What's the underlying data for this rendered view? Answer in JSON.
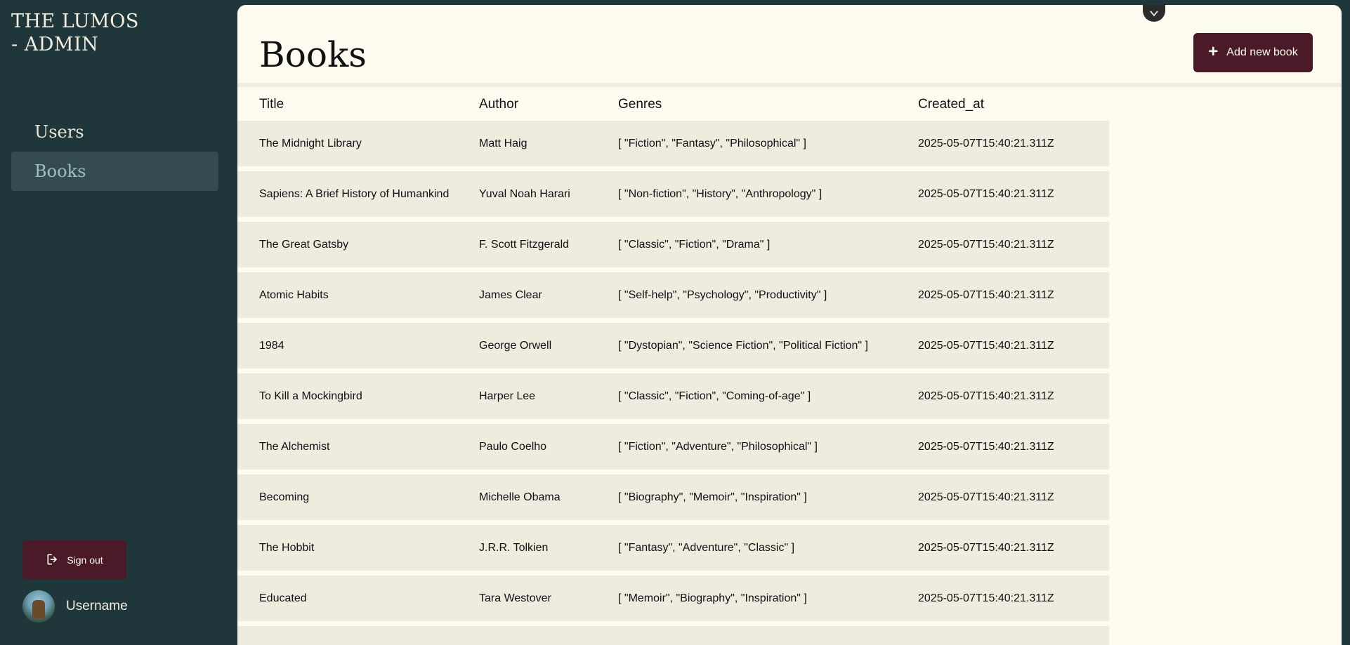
{
  "brand": {
    "title": "THE LUMOS - ADMIN"
  },
  "sidebar": {
    "items": [
      {
        "label": "Users"
      },
      {
        "label": "Books"
      }
    ],
    "signout_label": "Sign out",
    "username": "Username"
  },
  "main": {
    "title": "Books",
    "add_button_label": "Add new book",
    "columns": [
      "Title",
      "Author",
      "Genres",
      "Created_at"
    ],
    "rows": [
      {
        "title": "The Midnight Library",
        "author": "Matt Haig",
        "genres": "[ \"Fiction\", \"Fantasy\", \"Philosophical\" ]",
        "created_at": "2025-05-07T15:40:21.311Z"
      },
      {
        "title": "Sapiens: A Brief History of Humankind",
        "author": "Yuval Noah Harari",
        "genres": "[ \"Non-fiction\", \"History\", \"Anthropology\" ]",
        "created_at": "2025-05-07T15:40:21.311Z"
      },
      {
        "title": "The Great Gatsby",
        "author": "F. Scott Fitzgerald",
        "genres": "[ \"Classic\", \"Fiction\", \"Drama\" ]",
        "created_at": "2025-05-07T15:40:21.311Z"
      },
      {
        "title": "Atomic Habits",
        "author": "James Clear",
        "genres": "[ \"Self-help\", \"Psychology\", \"Productivity\" ]",
        "created_at": "2025-05-07T15:40:21.311Z"
      },
      {
        "title": "1984",
        "author": "George Orwell",
        "genres": "[ \"Dystopian\", \"Science Fiction\", \"Political Fiction\" ]",
        "created_at": "2025-05-07T15:40:21.311Z"
      },
      {
        "title": "To Kill a Mockingbird",
        "author": "Harper Lee",
        "genres": "[ \"Classic\", \"Fiction\", \"Coming-of-age\" ]",
        "created_at": "2025-05-07T15:40:21.311Z"
      },
      {
        "title": "The Alchemist",
        "author": "Paulo Coelho",
        "genres": "[ \"Fiction\", \"Adventure\", \"Philosophical\" ]",
        "created_at": "2025-05-07T15:40:21.311Z"
      },
      {
        "title": "Becoming",
        "author": "Michelle Obama",
        "genres": "[ \"Biography\", \"Memoir\", \"Inspiration\" ]",
        "created_at": "2025-05-07T15:40:21.311Z"
      },
      {
        "title": "The Hobbit",
        "author": "J.R.R. Tolkien",
        "genres": "[ \"Fantasy\", \"Adventure\", \"Classic\" ]",
        "created_at": "2025-05-07T15:40:21.311Z"
      },
      {
        "title": "Educated",
        "author": "Tara Westover",
        "genres": "[ \"Memoir\", \"Biography\", \"Inspiration\" ]",
        "created_at": "2025-05-07T15:40:21.311Z"
      },
      {
        "title": "",
        "author": "",
        "genres": "",
        "created_at": ""
      }
    ]
  },
  "colors": {
    "sidebar_bg": "#1f363b",
    "active_nav_bg": "#344c51",
    "accent_button": "#4a1a28",
    "main_bg": "#fefcf0",
    "row_bg": "#efebdf"
  },
  "icons": {
    "signout": "logout-icon",
    "add": "plus-icon",
    "collapse": "chevron-down-icon",
    "avatar": "avatar"
  }
}
